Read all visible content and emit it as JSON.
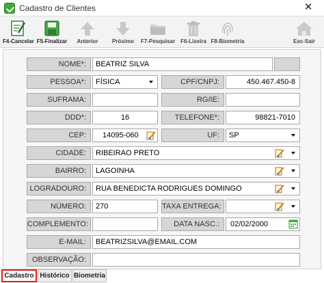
{
  "window": {
    "title": "Cadastro de Clientes",
    "close": "✕"
  },
  "toolbar": [
    {
      "label": "F4-Cancelar",
      "icon": "edit-form-icon"
    },
    {
      "label": "F5-Finalizar",
      "icon": "save-disk-icon"
    },
    {
      "label": "Anterior",
      "icon": "arrow-up-icon"
    },
    {
      "label": "Próximo",
      "icon": "arrow-down-icon"
    },
    {
      "label": "F7-Pesquisar",
      "icon": "folder-icon"
    },
    {
      "label": "F6-Lixeira",
      "icon": "trash-icon"
    },
    {
      "label": "F8-Biometria",
      "icon": "fingerprint-icon"
    },
    {
      "label": "Esc-Sair",
      "icon": "home-icon"
    }
  ],
  "form": {
    "nome": {
      "label": "NOME*:",
      "value": "BEATRIZ SILVA"
    },
    "pessoa": {
      "label": "PESSOA*:",
      "value": "FÍSICA"
    },
    "cpf": {
      "label": "CPF/CNPJ:",
      "value": "450.467.450-8"
    },
    "suframa": {
      "label": "SUFRAMA:",
      "value": ""
    },
    "rg": {
      "label": "RG/IE:",
      "value": ""
    },
    "ddd": {
      "label": "DDD*:",
      "value": "16"
    },
    "telefone": {
      "label": "TELEFONE*:",
      "value": "98821-7010"
    },
    "cep": {
      "label": "CEP:",
      "value": "14095-060"
    },
    "uf": {
      "label": "UF:",
      "value": "SP"
    },
    "cidade": {
      "label": "CIDADE:",
      "value": "RIBEIRAO PRETO"
    },
    "bairro": {
      "label": "BAIRRO:",
      "value": "LAGOINHA"
    },
    "logradouro": {
      "label": "LOGRADOURO:",
      "value": "RUA BENEDICTA RODRIGUES DOMINGO"
    },
    "numero": {
      "label": "NÚMERO:",
      "value": "270"
    },
    "taxa": {
      "label": "TAXA ENTREGA:",
      "value": ""
    },
    "complemento": {
      "label": "COMPLEMENTO:",
      "value": ""
    },
    "data_nasc": {
      "label": "DATA NASC.:",
      "value": "02/02/2000"
    },
    "email": {
      "label": "E-MAIL:",
      "value": "BEATRIZSILVA@EMAIL.COM"
    },
    "observacao": {
      "label": "OBSERVAÇÃO:",
      "value": ""
    }
  },
  "tabs": [
    {
      "label": "Cadastro",
      "active": true
    },
    {
      "label": "Histórico",
      "active": false
    },
    {
      "label": "Biometria",
      "active": false
    }
  ],
  "colors": {
    "active_tab_border": "#e01a1a",
    "label_bg": "#d6d6d6",
    "accent_green": "#3fa93a"
  }
}
